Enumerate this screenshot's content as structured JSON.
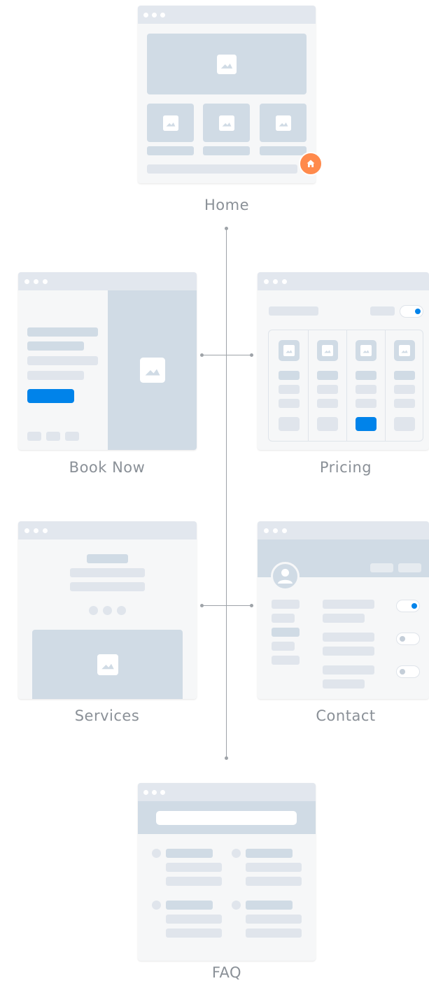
{
  "pages": {
    "home": {
      "label": "Home",
      "badge_icon": "home-icon"
    },
    "book_now": {
      "label": "Book Now"
    },
    "pricing": {
      "label": "Pricing"
    },
    "services": {
      "label": "Services"
    },
    "contact": {
      "label": "Contact"
    },
    "faq": {
      "label": "FAQ"
    }
  },
  "colors": {
    "card": "#f6f7f8",
    "topbar": "#e2e7ee",
    "placeholder": "#e0e5ec",
    "image": "#d0dbe5",
    "accent": "#0083ea",
    "home_badge": "#ff8a4c",
    "connector": "#9ea3a8",
    "label": "#8a9097"
  }
}
